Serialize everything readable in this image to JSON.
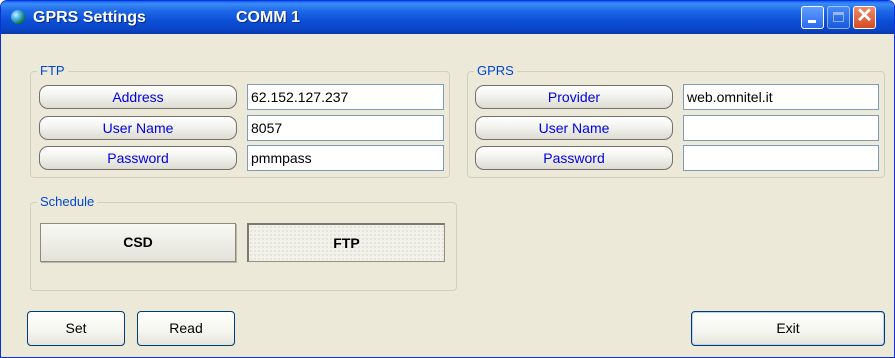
{
  "window": {
    "title": "GPRS Settings",
    "subtitle": "COMM 1",
    "controls": {
      "minimize": "minimize-icon",
      "maximize": "maximize-icon",
      "close": "close-icon"
    }
  },
  "ftp": {
    "legend": "FTP",
    "rows": [
      {
        "label": "Address",
        "value": "62.152.127.237"
      },
      {
        "label": "User Name",
        "value": "8057"
      },
      {
        "label": "Password",
        "value": "pmmpass"
      }
    ]
  },
  "gprs": {
    "legend": "GPRS",
    "rows": [
      {
        "label": "Provider",
        "value": "web.omnitel.it"
      },
      {
        "label": "User Name",
        "value": ""
      },
      {
        "label": "Password",
        "value": ""
      }
    ]
  },
  "schedule": {
    "legend": "Schedule",
    "csd_label": "CSD",
    "ftp_label": "FTP",
    "selected": "FTP"
  },
  "buttons": {
    "set": "Set",
    "read": "Read",
    "exit": "Exit"
  },
  "colors": {
    "title_bar": "#0a45c8",
    "legend_text": "#0046d5",
    "label_text": "#0000e8",
    "window_bg": "#ece9d8"
  }
}
